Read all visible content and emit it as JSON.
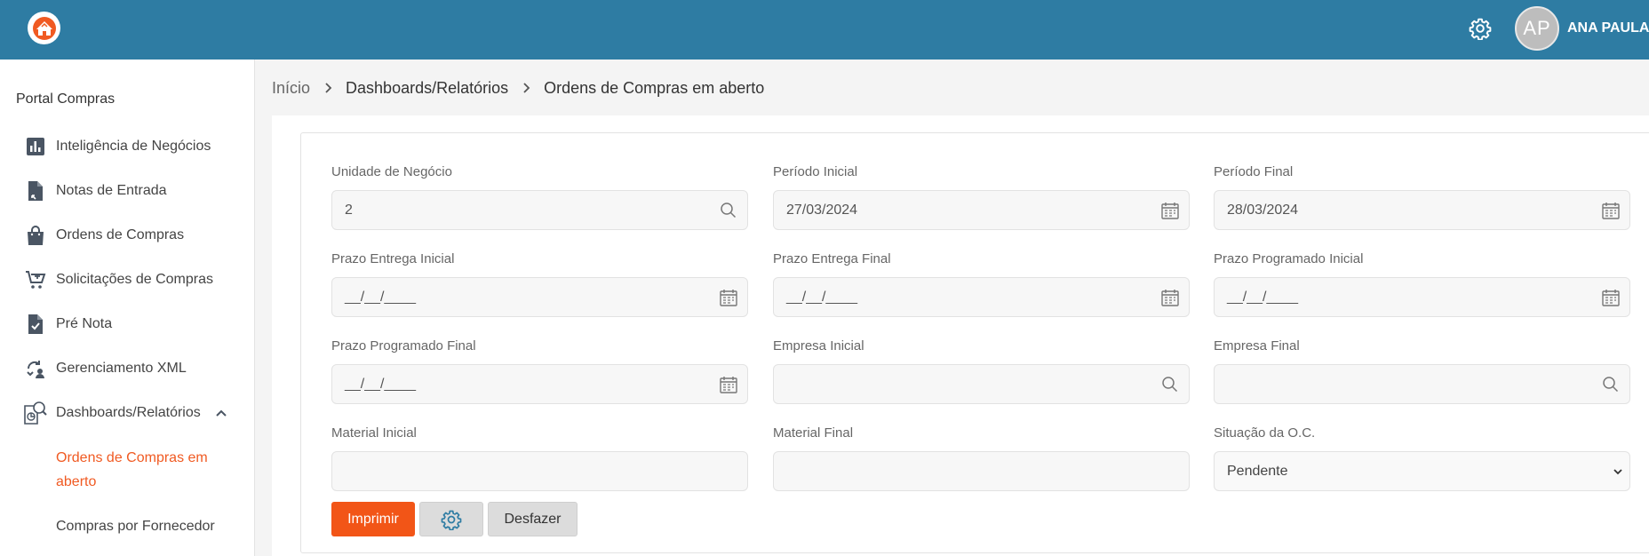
{
  "header": {
    "avatar_initials": "AP",
    "user_name": "ANA PAULA S"
  },
  "sidebar": {
    "title": "Portal Compras",
    "items": [
      {
        "label": "Inteligência de Negócios",
        "icon": "bar-chart-icon"
      },
      {
        "label": "Notas de Entrada",
        "icon": "document-import-icon"
      },
      {
        "label": "Ordens de Compras",
        "icon": "shopping-bag-icon"
      },
      {
        "label": "Solicitações de Compras",
        "icon": "cart-add-icon"
      },
      {
        "label": "Pré Nota",
        "icon": "document-check-icon"
      },
      {
        "label": "Gerenciamento XML",
        "icon": "xml-manage-icon"
      },
      {
        "label": "Dashboards/Relatórios",
        "icon": "report-search-icon"
      }
    ],
    "sub_items": [
      {
        "label": "Ordens de Compras em aberto",
        "active": true
      },
      {
        "label": "Compras por Fornecedor",
        "active": false
      }
    ]
  },
  "breadcrumb": {
    "home": "Início",
    "section": "Dashboards/Relatórios",
    "current": "Ordens de Compras em aberto"
  },
  "form": {
    "unidade_negocio": {
      "label": "Unidade de Negócio",
      "value": "2"
    },
    "periodo_inicial": {
      "label": "Período Inicial",
      "value": "27/03/2024"
    },
    "periodo_final": {
      "label": "Período Final",
      "value": "28/03/2024"
    },
    "prazo_entrega_inicial": {
      "label": "Prazo Entrega Inicial",
      "value": "__/__/____"
    },
    "prazo_entrega_final": {
      "label": "Prazo Entrega Final",
      "value": "__/__/____"
    },
    "prazo_programado_inicial": {
      "label": "Prazo Programado Inicial",
      "value": "__/__/____"
    },
    "prazo_programado_final": {
      "label": "Prazo Programado Final",
      "value": "__/__/____"
    },
    "empresa_inicial": {
      "label": "Empresa Inicial",
      "value": ""
    },
    "empresa_final": {
      "label": "Empresa Final",
      "value": ""
    },
    "material_inicial": {
      "label": "Material Inicial",
      "value": ""
    },
    "material_final": {
      "label": "Material Final",
      "value": ""
    },
    "situacao_oc": {
      "label": "Situação da O.C.",
      "value": "Pendente"
    }
  },
  "buttons": {
    "print_label": "Imprimir",
    "undo_label": "Desfazer"
  },
  "colors": {
    "header_bg": "#2e7ca3",
    "accent": "#f25517",
    "active_link": "#f05a22"
  }
}
